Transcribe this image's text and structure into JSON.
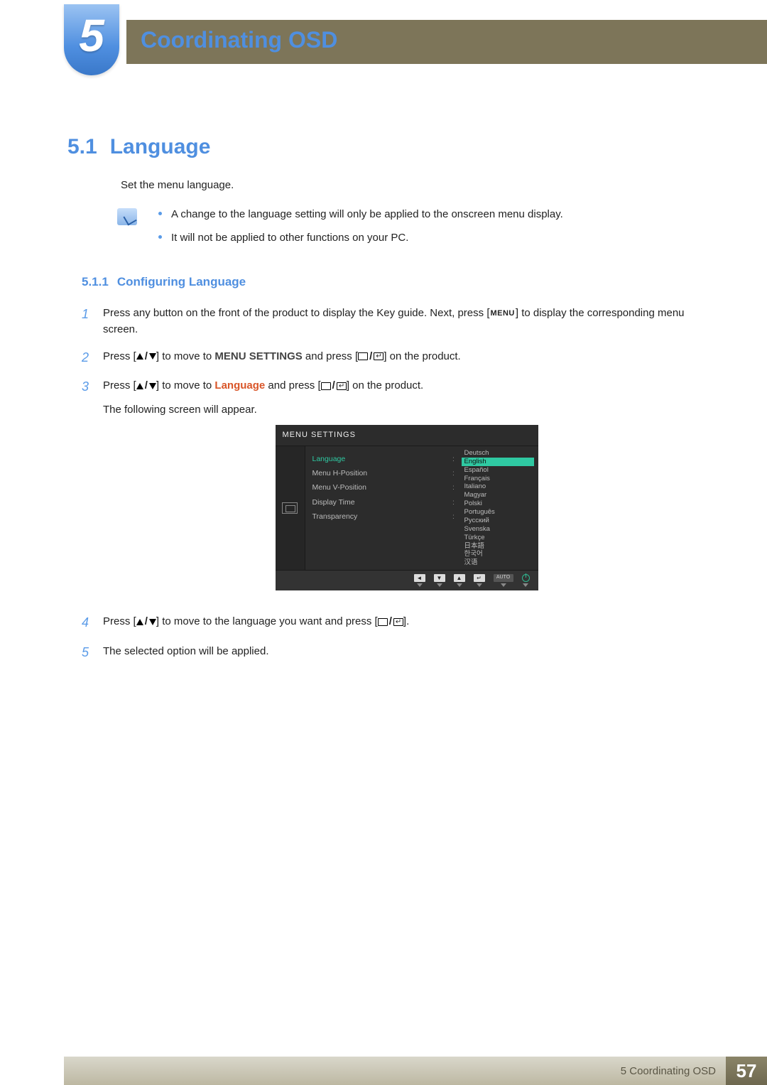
{
  "chapter": {
    "number": "5",
    "title": "Coordinating OSD"
  },
  "section": {
    "number": "5.1",
    "title": "Language",
    "intro": "Set the menu language."
  },
  "notes": [
    "A change to the language setting will only be applied to the onscreen menu display.",
    "It will not be applied to other functions on your PC."
  ],
  "subsection": {
    "number": "5.1.1",
    "title": "Configuring Language"
  },
  "steps": {
    "s1a": "Press any button on the front of the product to display the Key guide. Next, press [",
    "s1b": "] to display the corresponding menu screen.",
    "s2a": "Press [",
    "s2b": "] to move to ",
    "s2c": "MENU SETTINGS",
    "s2d": " and press [",
    "s2e": "] on the product.",
    "s3a": "Press [",
    "s3b": "] to move to ",
    "s3c": "Language",
    "s3d": " and press [",
    "s3e": "] on the product.",
    "s3f": "The following screen will appear.",
    "s4a": "Press [",
    "s4b": "] to move to the language you want and press [",
    "s4c": "].",
    "s5": "The selected option will be applied."
  },
  "menu_label": "MENU",
  "osd": {
    "title": "MENU SETTINGS",
    "left_items": [
      "Language",
      "Menu H-Position",
      "Menu V-Position",
      "Display Time",
      "Transparency"
    ],
    "languages": [
      "Deutsch",
      "English",
      "Español",
      "Français",
      "Italiano",
      "Magyar",
      "Polski",
      "Português",
      "Русский",
      "Svenska",
      "Türkçe",
      "日本語",
      "한국어",
      "汉语"
    ],
    "selected_language_index": 1,
    "foot_auto": "AUTO"
  },
  "footer": {
    "label": "5 Coordinating OSD",
    "page": "57"
  }
}
